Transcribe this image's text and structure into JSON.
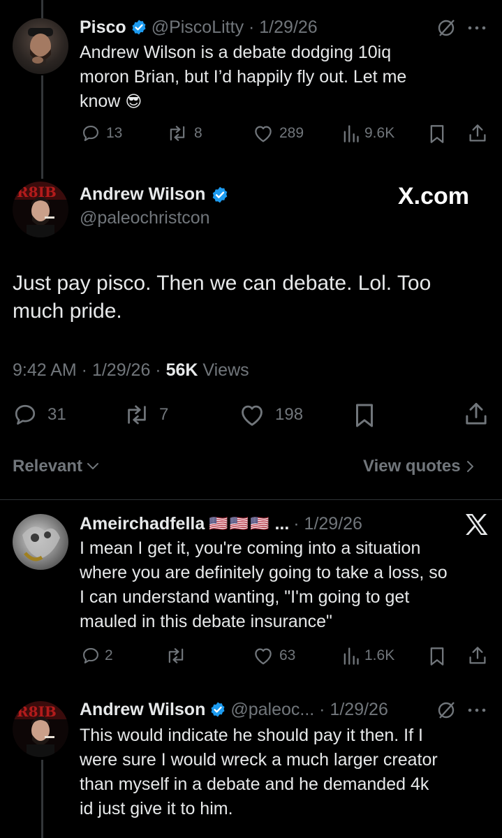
{
  "colors": {
    "background": "#000000",
    "text": "#e7e9ea",
    "muted": "#71767b",
    "verified": "#1d9bf0",
    "divider": "#2f3336"
  },
  "tweet1": {
    "name": "Pisco",
    "handle_date": "@PiscoLitty · 1/29/26",
    "lines": [
      "Andrew Wilson is a debate dodging 10iq",
      "moron Brian, but I’d happily fly out. Let me",
      "know"
    ],
    "emoji": "😎",
    "replies": "13",
    "reposts": "8",
    "likes": "289",
    "views": "9.6K"
  },
  "main_tweet": {
    "name": "Andrew Wilson",
    "handle": "@paleochristcon",
    "watermark": "X.com",
    "lines": [
      "Just pay pisco. Then we can debate. Lol. Too",
      "much pride."
    ],
    "meta_time": "9:42 AM · 1/29/26 · ",
    "meta_views_count": "56K",
    "meta_views_label": " Views",
    "replies": "31",
    "reposts": "7",
    "likes": "198"
  },
  "sort": {
    "relevant": "Relevant",
    "view_quotes": "View quotes"
  },
  "reply1": {
    "name": "Ameirchadfella",
    "flags": "🇺🇸🇺🇸🇺🇸",
    "ellipsis": "...",
    "date": "· 1/29/26",
    "lines": [
      "I mean I get it, you're coming into a situation",
      "where you are definitely going to take a loss, so",
      "I can understand wanting, \"I'm going to get",
      "mauled in this debate insurance\""
    ],
    "replies": "2",
    "likes": "63",
    "views": "1.6K"
  },
  "reply2": {
    "name": "Andrew Wilson",
    "handle_date": "@paleoc... · 1/29/26",
    "lines": [
      "This would indicate he should pay it then. If I",
      "were sure I would wreck a much larger creator",
      "than myself in a debate and he demanded 4k",
      "id just give it to him."
    ]
  }
}
